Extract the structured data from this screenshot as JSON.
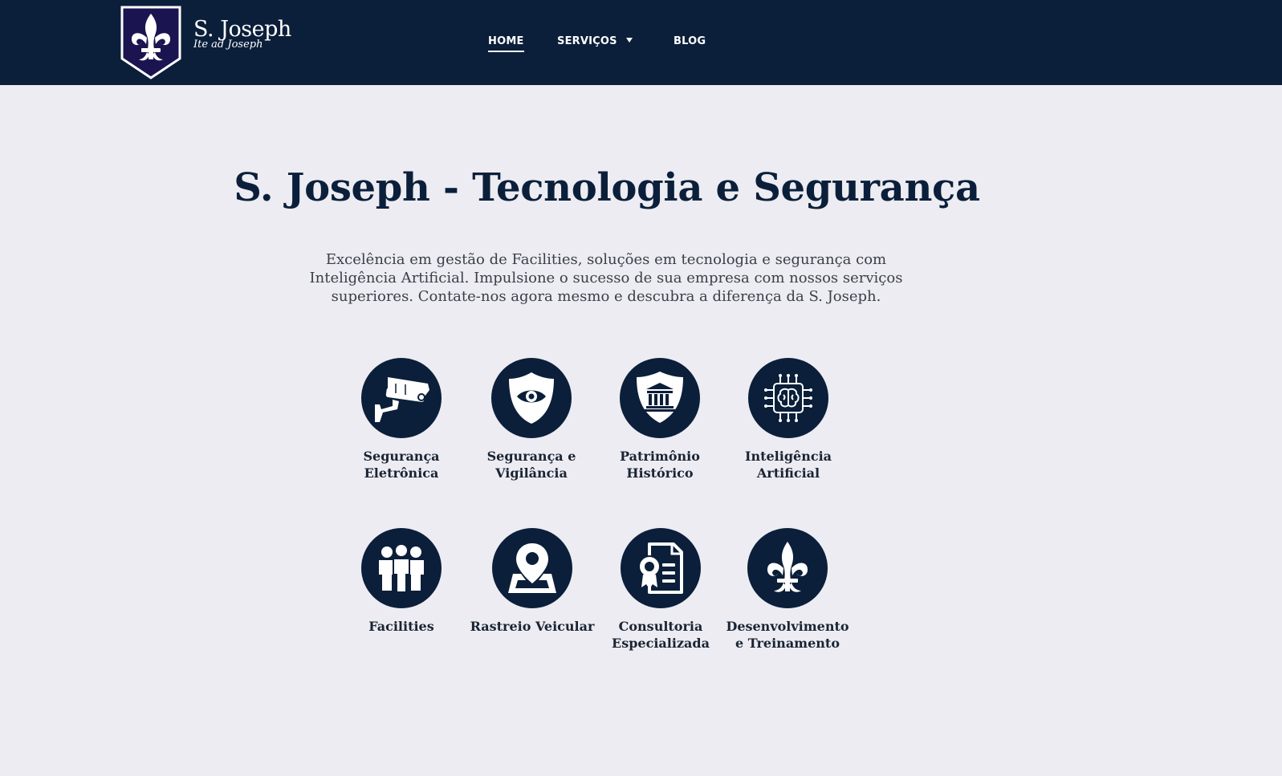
{
  "brand": {
    "name": "S. Joseph",
    "tagline": "Ite ad Joseph",
    "colors": {
      "primary": "#0b1f3a",
      "shield": "#1a1550",
      "background": "#ececf2"
    }
  },
  "nav": {
    "items": [
      {
        "label": "HOME",
        "active": true
      },
      {
        "label": "SERVIÇOS",
        "has_dropdown": true
      },
      {
        "label": "BLOG"
      }
    ]
  },
  "hero": {
    "title": "S. Joseph - Tecnologia e Segurança",
    "description": "Excelência em gestão de Facilities, soluções em tecnologia e segurança com Inteligência Artificial. Impulsione o sucesso de sua empresa com nossos serviços superiores. Contate-nos agora mesmo e descubra a diferença da S. Joseph."
  },
  "services": [
    {
      "label": "Segurança Eletrônica",
      "icon": "cctv-camera-icon"
    },
    {
      "label": "Segurança e Vigilância",
      "icon": "shield-eye-icon"
    },
    {
      "label": "Patrimônio Histórico",
      "icon": "museum-laurel-icon"
    },
    {
      "label": "Inteligência Artificial",
      "icon": "ai-brain-chip-icon"
    },
    {
      "label": "Facilities",
      "icon": "team-icon"
    },
    {
      "label": "Rastreio Veicular",
      "icon": "map-pin-icon"
    },
    {
      "label": "Consultoria Especializada",
      "icon": "certificate-document-icon"
    },
    {
      "label": "Desenvolvimento e Treinamento",
      "icon": "fleur-de-lis-icon"
    }
  ]
}
